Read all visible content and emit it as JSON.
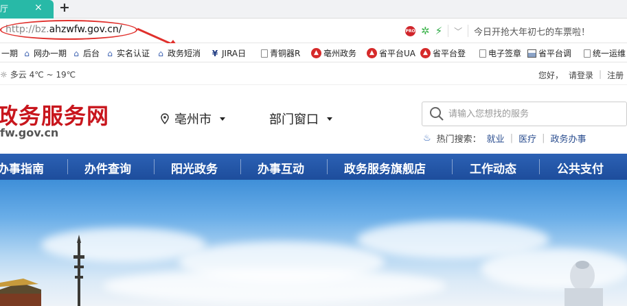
{
  "browser": {
    "tab_title": "厅",
    "tab_close": "×",
    "new_tab": "+",
    "url_proto": "http://bz.",
    "url_host": "ahzwfw.gov.cn/",
    "promo_text": "今日开抢大年初七的车票啦！",
    "pro_label": "PRO"
  },
  "bookmarks": [
    {
      "icon": "house-icon",
      "label": "一期"
    },
    {
      "icon": "house-icon",
      "label": "网办一期"
    },
    {
      "icon": "house-icon",
      "label": "后台"
    },
    {
      "icon": "house-icon",
      "label": "实名认证"
    },
    {
      "icon": "house-icon",
      "label": "政务短消"
    },
    {
      "icon": "jira-icon",
      "label": "JIRA日"
    },
    {
      "icon": "doc-icon",
      "label": "青铜器R"
    },
    {
      "icon": "emblem-icon",
      "label": "亳州政务"
    },
    {
      "icon": "emblem-icon",
      "label": "省平台UA"
    },
    {
      "icon": "emblem-icon",
      "label": "省平台登"
    },
    {
      "icon": "doc-icon",
      "label": "电子签章"
    },
    {
      "icon": "image-icon",
      "label": "省平台调"
    },
    {
      "icon": "doc-icon",
      "label": "统一运维"
    }
  ],
  "site": {
    "weather": "多云 4℃ ~ 19℃",
    "greeting": "您好，",
    "login": "请登录",
    "register": "注册",
    "logo_cn": "政务服务网",
    "logo_en": "fw.gov.cn",
    "city": "亳州市",
    "dept": "部门窗口",
    "search_placeholder": "请输入您想找的服务",
    "hot_label": "热门搜索：",
    "hot_links": [
      "就业",
      "医疗",
      "政务办事"
    ]
  },
  "nav": [
    "办事指南",
    "办件查询",
    "阳光政务",
    "办事互动",
    "政务服务旗舰店",
    "工作动态",
    "公共支付"
  ],
  "colors": {
    "tab": "#28b9a7",
    "nav": "#2560b0",
    "logo": "#c8161d",
    "annotation": "#e0302c"
  }
}
